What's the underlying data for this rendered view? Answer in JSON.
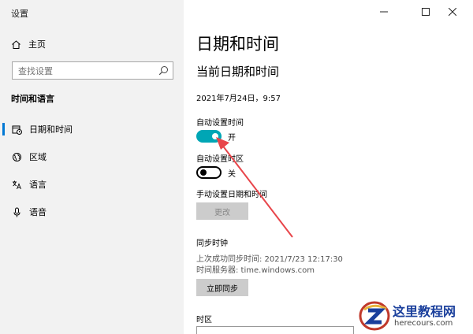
{
  "window": {
    "title": "设置"
  },
  "sidebar": {
    "home_label": "主页",
    "search_placeholder": "查找设置",
    "section_title": "时间和语言",
    "items": [
      {
        "label": "日期和时间",
        "icon": "calendar-clock-icon",
        "active": true
      },
      {
        "label": "区域",
        "icon": "globe-icon",
        "active": false
      },
      {
        "label": "语言",
        "icon": "language-icon",
        "active": false
      },
      {
        "label": "语音",
        "icon": "microphone-icon",
        "active": false
      }
    ]
  },
  "main": {
    "page_title": "日期和时间",
    "section_title": "当前日期和时间",
    "current_datetime": "2021年7月24日，9:57",
    "auto_time": {
      "label": "自动设置时间",
      "state_label": "开",
      "on": true
    },
    "auto_timezone": {
      "label": "自动设置时区",
      "state_label": "关",
      "on": false
    },
    "manual": {
      "label": "手动设置日期和时间",
      "button": "更改"
    },
    "sync": {
      "title": "同步时钟",
      "last_sync": "上次成功同步时间: 2021/7/23 12:17:30",
      "server": "时间服务器: time.windows.com",
      "button": "立即同步"
    },
    "timezone_title": "时区"
  },
  "watermark": {
    "text": "这里教程网",
    "url": "herecours.com"
  },
  "colors": {
    "accent": "#0078d4",
    "toggle_on": "#00a6b5",
    "arrow": "#e8454a"
  }
}
